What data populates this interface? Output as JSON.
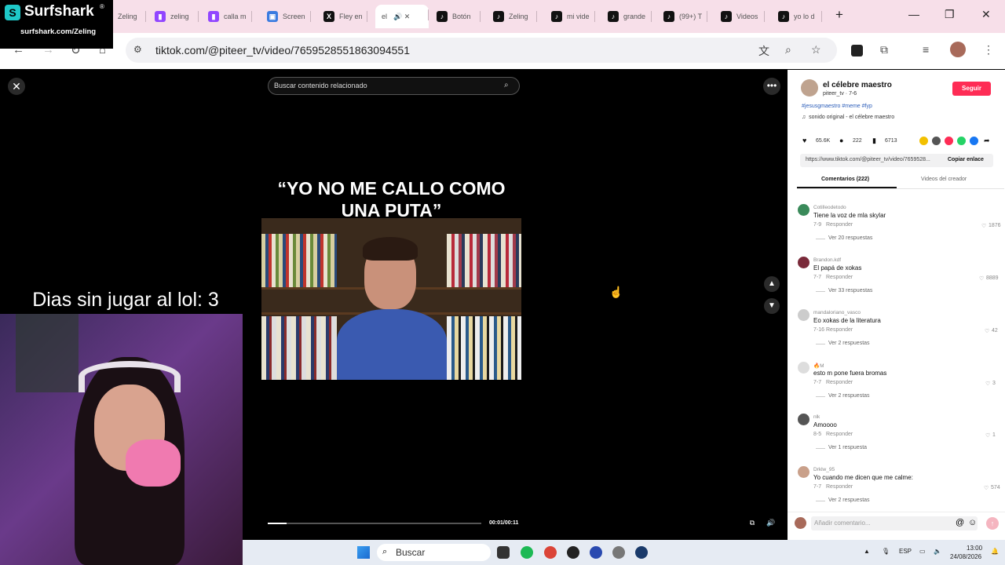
{
  "overlay": {
    "brand": "Surfshark",
    "brand_mark": "®",
    "promo": "surfshark.com/Zeling",
    "days_text": "Dias sin jugar al lol: 3"
  },
  "browser": {
    "tabs": [
      {
        "label": "Zeling",
        "icon": "tab-favicon",
        "active": false
      },
      {
        "label": "zeling",
        "icon": "twitch-icon",
        "active": false
      },
      {
        "label": "calla m",
        "icon": "twitch-icon",
        "active": false
      },
      {
        "label": "Screen",
        "icon": "screen-icon",
        "active": false
      },
      {
        "label": "Fley en",
        "icon": "x-icon",
        "active": false
      },
      {
        "label": "el",
        "icon": "audio-icon",
        "active": true
      },
      {
        "label": "Botón",
        "icon": "tiktok-icon",
        "active": false
      },
      {
        "label": "Zeling",
        "icon": "tiktok-icon",
        "active": false
      },
      {
        "label": "mi vide",
        "icon": "tiktok-icon",
        "active": false
      },
      {
        "label": "grande",
        "icon": "tiktok-icon",
        "active": false
      },
      {
        "label": "(99+) T",
        "icon": "tiktok-icon",
        "active": false
      },
      {
        "label": "Videos",
        "icon": "tiktok-icon",
        "active": false
      },
      {
        "label": "yo lo d",
        "icon": "tiktok-icon",
        "active": false
      }
    ],
    "url": "tiktok.com/@piteer_tv/video/7659528551863094551"
  },
  "player": {
    "search_placeholder": "Buscar contenido relacionado",
    "caption": "“YO NO ME CALLO COMO UNA PUTA”",
    "time": "00:01/00:11",
    "progress_fraction": 0.09
  },
  "post": {
    "author": "el célebre maestro",
    "handle": "piteer_tv · 7-6",
    "follow_label": "Seguir",
    "hashtags": "#jesusgmaestro #meme #fyp",
    "sound": "sonido original - el célebre maestro",
    "likes": "65.6K",
    "comments": "222",
    "saves": "6713",
    "link": "https://www.tiktok.com/@piteer_tv/video/7659528...",
    "copy_label": "Copiar enlace",
    "tab_comments": "Comentarios (222)",
    "tab_creator": "Videos del creador"
  },
  "comments": [
    {
      "user": "Cotilleodetodo",
      "text": "Tiene la voz de mla skylar",
      "date": "7-9",
      "reply": "Responder",
      "likes": "1876",
      "replies": "Ver 20 respuestas"
    },
    {
      "user": "Brandon.kdf",
      "text": "El papá de xokas",
      "date": "7-7",
      "reply": "Responder",
      "likes": "8889",
      "replies": "Ver 33 respuestas"
    },
    {
      "user": "mandaloriano_vasco",
      "text": "Eo xokas de la literatura",
      "date": "7-16",
      "reply": "Responder",
      "likes": "42",
      "replies": "Ver 2 respuestas"
    },
    {
      "user": "🔥M",
      "text": "esto m pone fuera bromas",
      "date": "7-7",
      "reply": "Responder",
      "likes": "3",
      "replies": "Ver 2 respuestas"
    },
    {
      "user": "nlk",
      "text": "Amoooo",
      "date": "8-5",
      "reply": "Responder",
      "likes": "1",
      "replies": "Ver 1 respuesta"
    },
    {
      "user": "Drklw_95",
      "text": "Yo cuando me dicen que me calme:",
      "date": "7-7",
      "reply": "Responder",
      "likes": "574",
      "replies": "Ver 2 respuestas"
    }
  ],
  "comment_input_placeholder": "Añadir comentario...",
  "taskbar": {
    "search_label": "Buscar",
    "lang": "ESP",
    "time": "13:00",
    "date": "24/08/2026"
  }
}
